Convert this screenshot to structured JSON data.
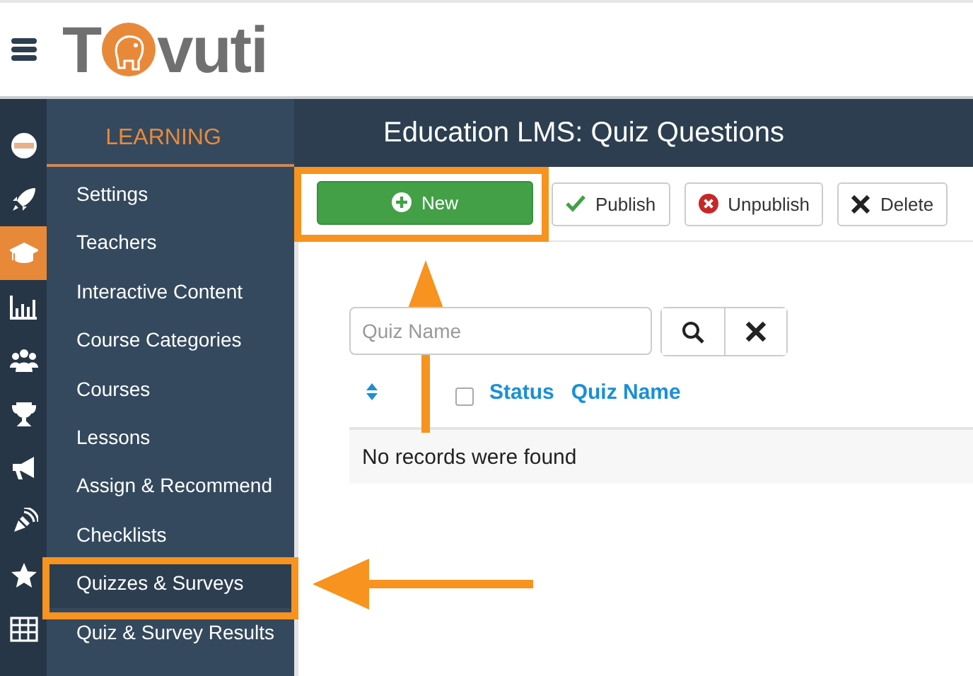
{
  "logo": {
    "first": "T",
    "rest": "vuti"
  },
  "rail": [
    {
      "kind": "face",
      "selected": false
    },
    {
      "kind": "rocket",
      "selected": false
    },
    {
      "kind": "cap",
      "selected": true
    },
    {
      "kind": "chart",
      "selected": false
    },
    {
      "kind": "people",
      "selected": false
    },
    {
      "kind": "trophy",
      "selected": false
    },
    {
      "kind": "megaphone",
      "selected": false
    },
    {
      "kind": "pen",
      "selected": false
    },
    {
      "kind": "star",
      "selected": false
    },
    {
      "kind": "grid",
      "selected": false
    }
  ],
  "sidebar": {
    "heading": "LEARNING",
    "items": [
      {
        "label": "Settings",
        "selected": false
      },
      {
        "label": "Teachers",
        "selected": false
      },
      {
        "label": "Interactive Content",
        "selected": false
      },
      {
        "label": "Course Categories",
        "selected": false
      },
      {
        "label": "Courses",
        "selected": false
      },
      {
        "label": "Lessons",
        "selected": false
      },
      {
        "label": "Assign & Recommend",
        "selected": false
      },
      {
        "label": "Checklists",
        "selected": false
      },
      {
        "label": "Quizzes & Surveys",
        "selected": true
      },
      {
        "label": "Quiz & Survey Results",
        "selected": false
      }
    ]
  },
  "page_title": "Education LMS: Quiz Questions",
  "toolbar": [
    {
      "kind": "new",
      "label": "New",
      "highlighted": true
    },
    {
      "kind": "publish",
      "label": "Publish",
      "highlighted": false
    },
    {
      "kind": "unpublish",
      "label": "Unpublish",
      "highlighted": false
    },
    {
      "kind": "delete",
      "label": "Delete",
      "highlighted": false
    }
  ],
  "search": {
    "placeholder": "Quiz Name"
  },
  "table": {
    "select_all_checked": false,
    "columns": [
      "Status",
      "Quiz Name"
    ],
    "empty_message": "No records were found"
  }
}
